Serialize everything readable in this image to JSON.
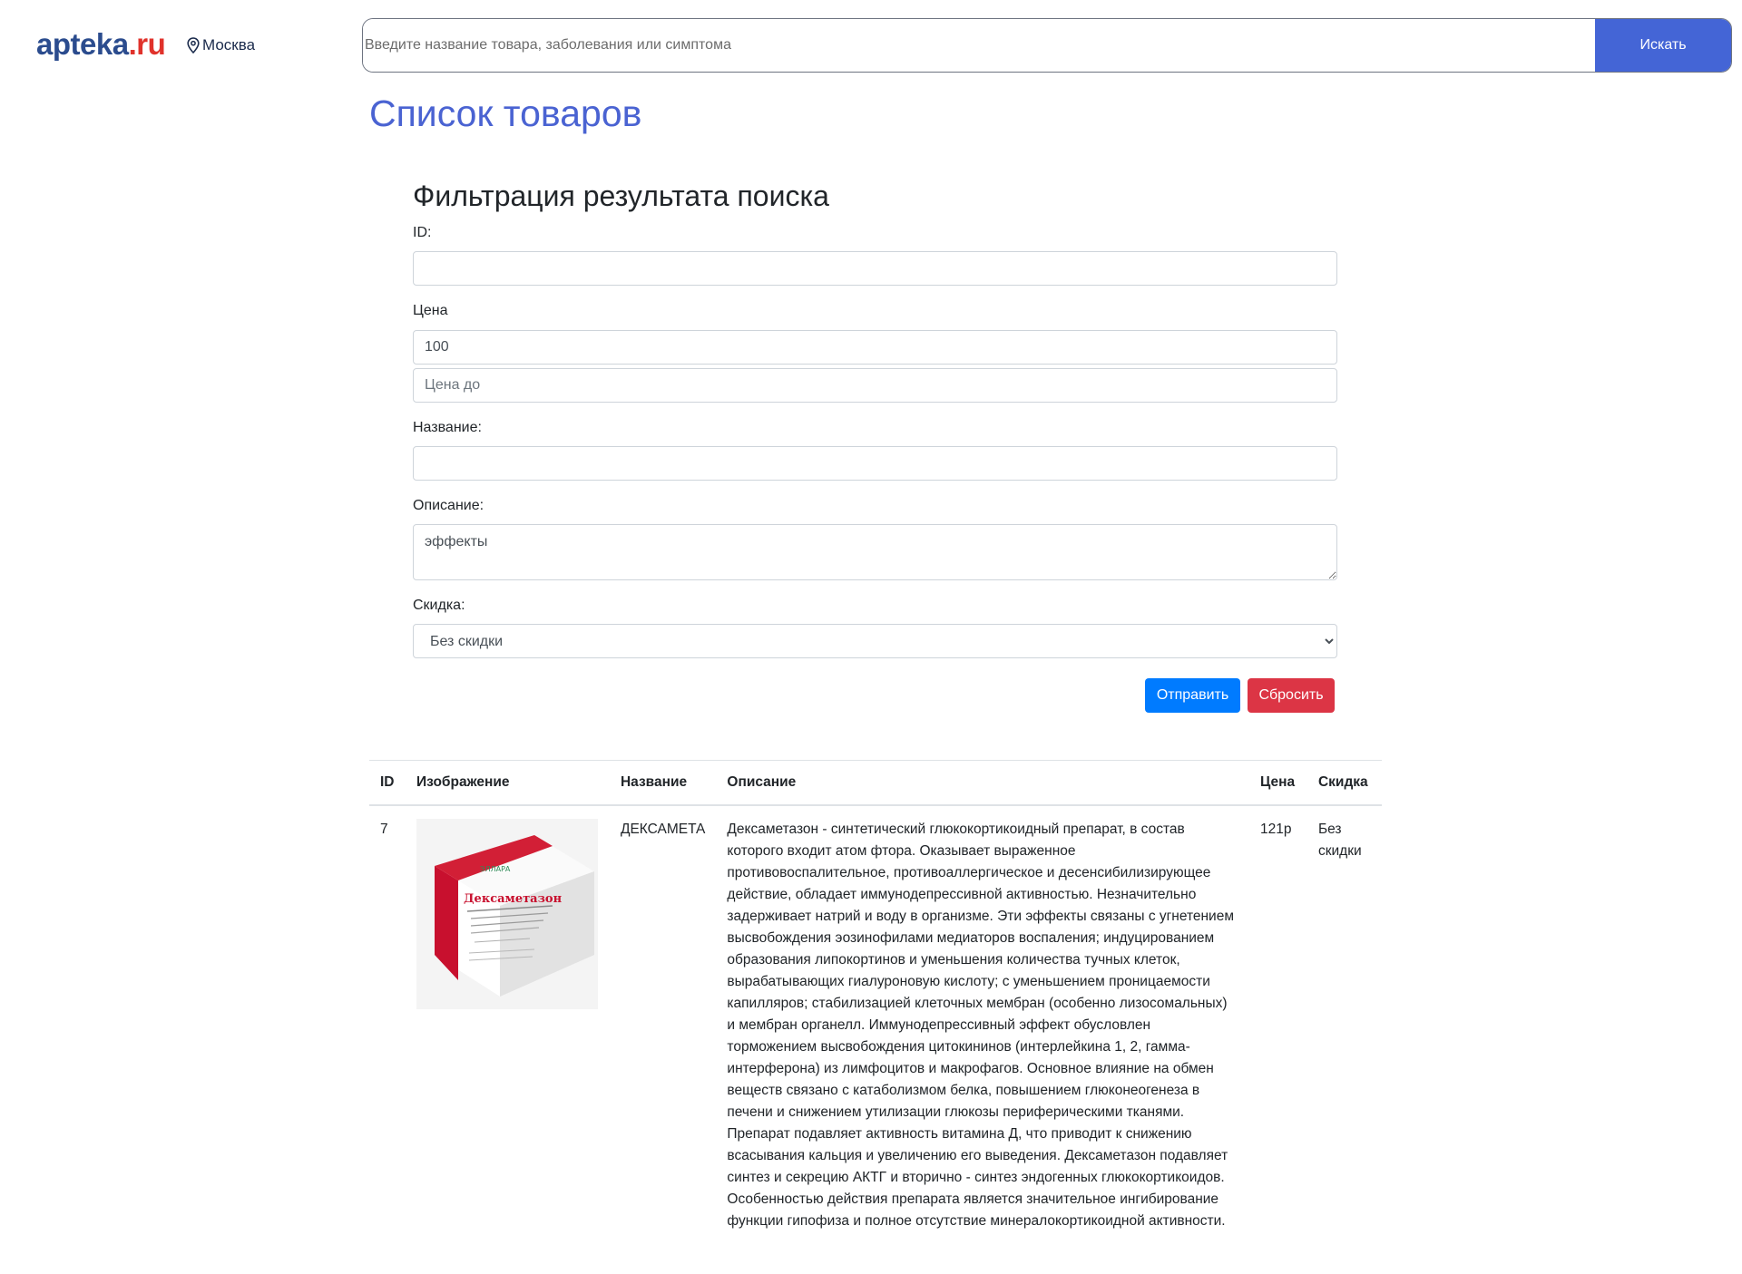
{
  "header": {
    "logo_main": "apteka",
    "logo_suffix": ".ru",
    "city": "Москва",
    "search_placeholder": "Введите название товара, заболевания или симптома",
    "search_button": "Искать"
  },
  "page_title": "Список товаров",
  "filter": {
    "heading": "Фильтрация результата поиска",
    "id_label": "ID:",
    "id_value": "",
    "price_label": "Цена",
    "price_from_value": "100",
    "price_to_placeholder": "Цена до",
    "name_label": "Название:",
    "name_value": "",
    "description_label": "Описание:",
    "description_value": "эффекты",
    "discount_label": "Скидка:",
    "discount_selected": "Без скидки",
    "submit_label": "Отправить",
    "reset_label": "Сбросить"
  },
  "table": {
    "columns": [
      "ID",
      "Изображение",
      "Название",
      "Описание",
      "Цена",
      "Скидка"
    ],
    "rows": [
      {
        "id": "7",
        "image_brand": "ЭЛЛАРА",
        "image_title": "Дексаметазон",
        "name": "ДЕКСАМЕТА",
        "description": "Дексаметазон - синтетический глюкокортикоидный препарат, в состав которого входит атом фтора. Оказывает выраженное противовоспалительное, противоаллергическое и десенсибилизирующее действие, обладает иммунодепрессивной активностью. Незначительно задерживает натрий и воду в организме. Эти эффекты связаны с угнетением высвобождения эозинофилами медиаторов воспаления; индуцированием образования липокортинов и уменьшения количества тучных клеток, вырабатывающих гиалуроновую кислоту; с уменьшением проницаемости капилляров; стабилизацией клеточных мембран (особенно лизосомальных) и мембран органелл. Иммунодепрессивный эффект обусловлен торможением высвобождения цитокининов (интерлейкина 1, 2, гамма-интерферона) из лимфоцитов и макрофагов. Основное влияние на обмен веществ связано с катаболизмом белка, повышением глюконеогенеза в печени и снижением утилизации глюкозы периферическими тканями. Препарат подавляет активность витамина Д, что приводит к снижению всасывания кальция и увеличению его выведения. Дексаметазон подавляет синтез и секрецию АКТГ и вторично - синтез эндогенных глюкокортикоидов. Особенностью действия препарата является значительное ингибирование функции гипофиза и полное отсутствие минералокортикоидной активности.",
        "price": "121р",
        "discount": "Без скидки"
      }
    ]
  },
  "colors": {
    "brand_blue": "#2b4c8e",
    "brand_red": "#e0322b",
    "title_blue": "#4a63d2",
    "search_button": "#4465d6",
    "submit": "#007bff",
    "reset": "#dc3545"
  },
  "icons": {
    "location": "map-pin-icon"
  }
}
